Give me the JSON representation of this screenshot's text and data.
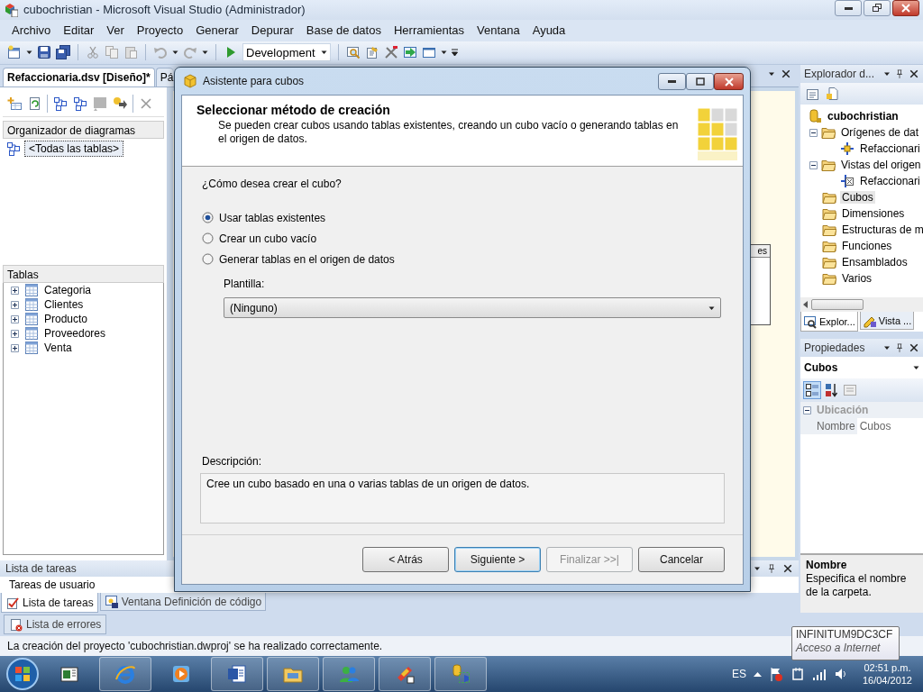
{
  "window": {
    "title": "cubochristian - Microsoft Visual Studio (Administrador)"
  },
  "menu": [
    "Archivo",
    "Editar",
    "Ver",
    "Proyecto",
    "Generar",
    "Depurar",
    "Base de datos",
    "Herramientas",
    "Ventana",
    "Ayuda"
  ],
  "toolbar": {
    "configuration": "Development"
  },
  "document_tabs": [
    {
      "label": "Refaccionaria.dsv [Diseño]*",
      "selected": true
    },
    {
      "label": "Pá",
      "selected": false
    }
  ],
  "diagram_organizer": {
    "header": "Organizador de diagramas",
    "items": [
      {
        "label": "<Todas las tablas>",
        "selected": true
      }
    ]
  },
  "tables": {
    "header": "Tablas",
    "items": [
      {
        "label": "Categoria",
        "expanded": false
      },
      {
        "label": "Clientes",
        "expanded": false
      },
      {
        "label": "Producto",
        "expanded": false
      },
      {
        "label": "Proveedores",
        "expanded": false
      },
      {
        "label": "Venta",
        "expanded": false
      }
    ]
  },
  "diagram": {
    "column_1": "es"
  },
  "task_list": {
    "title": "Lista de tareas",
    "filter": "Tareas de usuario"
  },
  "bottom_tabs": [
    {
      "label": "Lista de tareas",
      "selected": true
    },
    {
      "label": "Ventana Definición de código",
      "selected": false
    }
  ],
  "error_tab": {
    "label": "Lista de errores"
  },
  "status_bar": "La creación del proyecto 'cubochristian.dwproj' se ha realizado correctamente.",
  "solution_explorer": {
    "title": "Explorador d...",
    "root": "cubochristian",
    "items": [
      {
        "label": "Orígenes de dat",
        "selected": false,
        "expanded": true,
        "children": [
          {
            "label": "Refaccionari",
            "selected": false
          }
        ]
      },
      {
        "label": "Vistas del origen",
        "selected": false,
        "expanded": true,
        "children": [
          {
            "label": "Refaccionari",
            "selected": false
          }
        ]
      },
      {
        "label": "Cubos",
        "selected": true
      },
      {
        "label": "Dimensiones",
        "selected": false
      },
      {
        "label": "Estructuras de m",
        "selected": false
      },
      {
        "label": "Funciones",
        "selected": false
      },
      {
        "label": "Ensamblados",
        "selected": false
      },
      {
        "label": "Varios",
        "selected": false
      }
    ]
  },
  "panel_tabs": [
    {
      "label": "Explor...",
      "selected": true
    },
    {
      "label": "Vista ...",
      "selected": false
    }
  ],
  "properties": {
    "title": "Propiedades",
    "object": "Cubos",
    "category": "Ubicación",
    "rows": [
      {
        "name": "Nombre",
        "value": "Cubos"
      }
    ],
    "help_title": "Nombre",
    "help_text": "Especifica el nombre de la carpeta."
  },
  "dialog": {
    "title": "Asistente para cubos",
    "heading": "Seleccionar método de creación",
    "subheading": "Se pueden crear cubos usando tablas existentes, creando un cubo vacío o generando tablas en el origen de datos.",
    "question": "¿Cómo desea crear el cubo?",
    "options": [
      {
        "label": "Usar tablas existentes",
        "selected": true
      },
      {
        "label": "Crear un cubo vacío",
        "selected": false
      },
      {
        "label": "Generar tablas en el origen de datos",
        "selected": false
      }
    ],
    "template_label": "Plantilla:",
    "template_value": "(Ninguno)",
    "description_label": "Descripción:",
    "description": "Cree un cubo basado en una o varias tablas de un origen de datos.",
    "buttons": [
      {
        "label": "< Atrás",
        "disabled": false,
        "default": false
      },
      {
        "label": "Siguiente >",
        "disabled": false,
        "default": true
      },
      {
        "label": "Finalizar >>|",
        "disabled": true,
        "default": false
      },
      {
        "label": "Cancelar",
        "disabled": false,
        "default": false
      }
    ]
  },
  "taskbar": {
    "apps": [
      {
        "running": false
      },
      {
        "running": true
      },
      {
        "running": false
      },
      {
        "running": true
      },
      {
        "running": true
      },
      {
        "running": true
      },
      {
        "running": true
      },
      {
        "running": true
      }
    ],
    "language": "ES",
    "time": "02:51 p.m.",
    "date": "16/04/2012"
  },
  "tooltip": {
    "title": "INFINITUM9DC3CF",
    "subtitle": "Acceso a Internet"
  }
}
